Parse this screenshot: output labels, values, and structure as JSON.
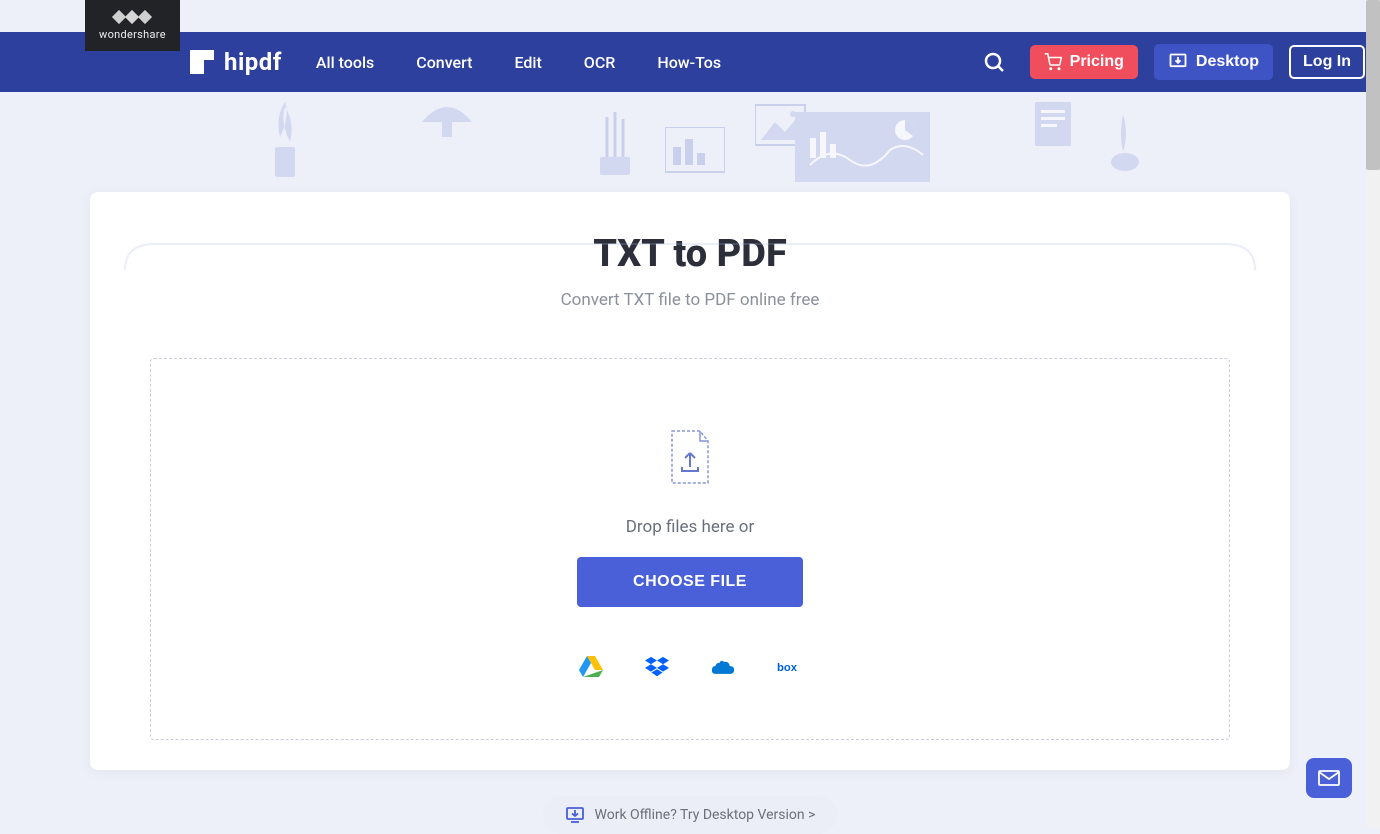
{
  "brand": {
    "parent": "wondershare",
    "product": "hipdf"
  },
  "nav": {
    "items": [
      "All tools",
      "Convert",
      "Edit",
      "OCR",
      "How-Tos"
    ]
  },
  "header": {
    "pricing_label": "Pricing",
    "desktop_label": "Desktop",
    "login_label": "Log In"
  },
  "page": {
    "title": "TXT to PDF",
    "subtitle": "Convert TXT file to PDF online free"
  },
  "dropzone": {
    "drop_text": "Drop files here or",
    "choose_label": "CHOOSE FILE"
  },
  "cloud_providers": [
    {
      "name": "google-drive",
      "color": "#4285F4"
    },
    {
      "name": "dropbox",
      "color": "#0061FF"
    },
    {
      "name": "onedrive",
      "color": "#0078D4"
    },
    {
      "name": "box",
      "color": "#0061D5"
    }
  ],
  "offline": {
    "text": "Work Offline? Try Desktop Version >"
  },
  "colors": {
    "primary": "#2d409d",
    "accent": "#4960d8",
    "pricing_bg": "#f04e5d",
    "page_bg": "#eef0f9"
  }
}
